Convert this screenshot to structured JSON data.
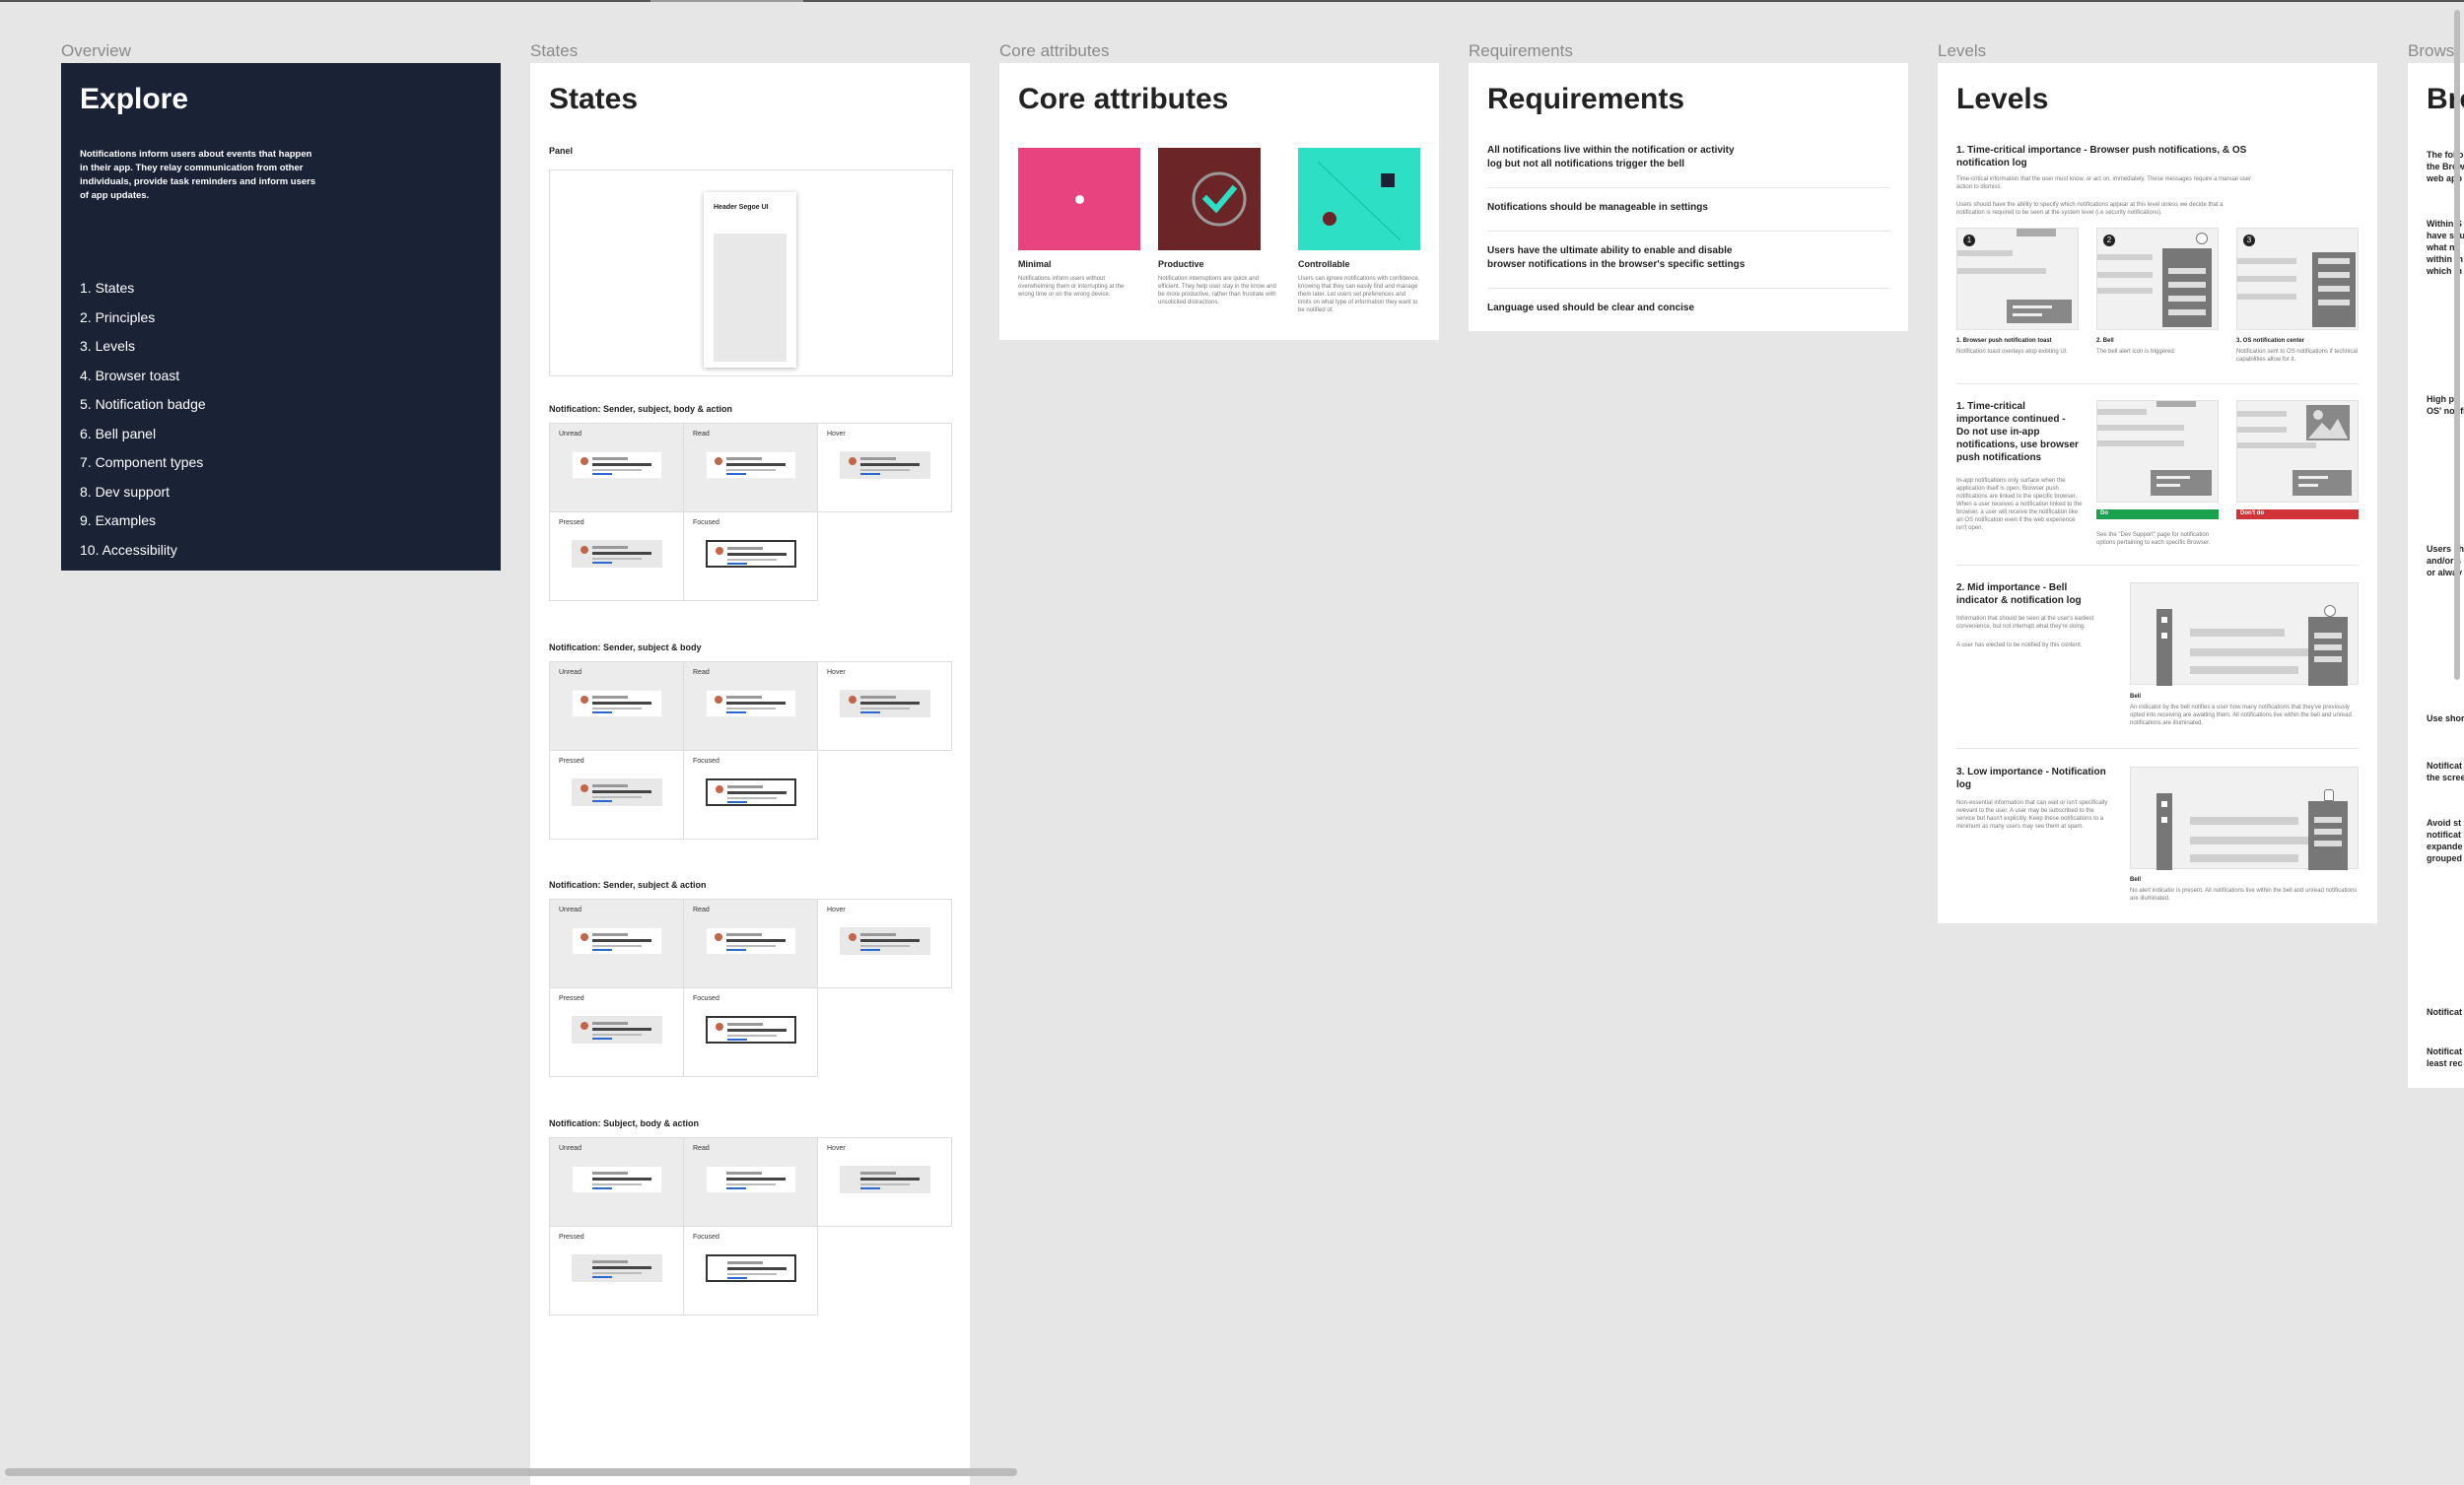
{
  "canvas": {
    "labels": [
      "Overview",
      "States",
      "Core attributes",
      "Requirements",
      "Levels",
      "Browse"
    ]
  },
  "overview": {
    "title": "Explore",
    "intro": "Notifications inform users about events that happen in their app. They relay communication from other individuals, provide task reminders and inform users of app updates.",
    "toc": [
      "1. States",
      "2. Principles",
      "3. Levels",
      "4. Browser toast",
      "5. Notification badge",
      "6. Bell panel",
      "7. Component types",
      "8. Dev support",
      "9. Examples",
      "10. Accessibility"
    ]
  },
  "states": {
    "title": "States",
    "panel_label": "Panel",
    "panel_header": "Header Segoe UI",
    "sections": [
      {
        "title": "Notification: Sender, subject, body & action"
      },
      {
        "title": "Notification: Sender, subject & body"
      },
      {
        "title": "Notification: Sender, subject & action"
      },
      {
        "title": "Notification: Subject, body & action"
      }
    ],
    "cell_labels": [
      "Unread",
      "Read",
      "Hover",
      "Pressed",
      "Focused"
    ]
  },
  "core": {
    "title": "Core attributes",
    "items": [
      {
        "name": "Minimal",
        "desc": "Notifications inform users without overwhelming them or interrupting at the wrong time or on the wrong device.",
        "color": "#e8427f"
      },
      {
        "name": "Productive",
        "desc": "Notification interruptions are quick and efficient. They help user stay in the know and be more productive, rather than frustrate with unsolicited distractions.",
        "color": "#6b2526"
      },
      {
        "name": "Controllable",
        "desc": "Users can ignore notifications with confidence, knowing that they can easily find and manage them later. Let users set preferences and limits on what type of information they want to be notified of.",
        "color": "#2de0c5"
      }
    ]
  },
  "requirements": {
    "title": "Requirements",
    "items": [
      "All notifications live within the notification or activity log but not all notifications trigger the bell",
      "Notifications should be manageable in settings",
      "Users have the ultimate ability to enable and disable browser notifications in the browser's specific settings",
      "Language used should be clear and concise"
    ]
  },
  "levels": {
    "title": "Levels",
    "s1_title": "1. Time-critical importance - Browser push notifications, & OS notification log",
    "s1_desc": "Time-critical information that the user must know, or act on, immediately. These messages require a manual user action to dismiss.",
    "s1_desc2": "Users should have the ability to specify which notifications appear at this level unless we decide that a notification is required to be seen at the system level (i.e security notifications).",
    "s1_captions": [
      {
        "num": "1",
        "title": "1. Browser push notification toast",
        "desc": "Notification toast overlays atop existing UI."
      },
      {
        "num": "2",
        "title": "2. Bell",
        "desc": "The bell alert icon is triggered."
      },
      {
        "num": "3",
        "title": "3. OS notification center",
        "desc": "Notification sent to OS notifications if technical capabilities allow for it."
      }
    ],
    "s2_title": "1. Time-critical importance continued - Do not use in-app notifications, use browser push notifications",
    "s2_desc": "In-app notifications only surface when the application itself is open. Browser push notifications are linked to the specific browser. When a user receives a notification linked to the browser, a user will receive the notification like an OS notification even if the web experience isn't open.",
    "s2_do": "Do",
    "s2_dont": "Don't do",
    "s2_caption": "See the \"Dev Support\" page for notification options pertaining to each specific Browser.",
    "s3_title": "2. Mid importance - Bell indicator & notification log",
    "s3_desc": "Information that should be seen at the user's earliest convenience, but not interrupt what they're doing.",
    "s3_desc2": "A user has elected to be notified by this content.",
    "s3_caption_title": "Bell",
    "s3_caption": "An indicator by the bell notifies a user how many notifications that they've previously opted into receiving are awaiting them. All notifications live within the bell and unread notifications are illuminated.",
    "s4_title": "3. Low importance - Notification log",
    "s4_desc": "Non-essential information that can wait or isn't specifically relevant to the user. A user may be subscribed to the service but hasn't explicitly. Keep these notifications to a minimum as many users may see them at spam.",
    "s4_caption_title": "Bell",
    "s4_caption": "No alert indicator is present. All notifications live within the bell and unread notifications are illuminated."
  },
  "browse": {
    "title": "Bro",
    "lines": [
      "The follo",
      "the Brow",
      "web app",
      "Within S",
      "have situ",
      "what no",
      "within th",
      "which m",
      "High pri",
      "OS' notifi",
      "Users sh",
      "and/or s",
      "or alway",
      "Use shor",
      "Notificat",
      "the scree",
      "Avoid st",
      "notificat",
      "expande",
      "grouped",
      "Notificat",
      "Notificat",
      "least rec"
    ]
  },
  "colors": {
    "overview_bg": "#1a2235",
    "do_green": "#1aa14b",
    "dont_red": "#d13438",
    "link_blue": "#2a6ad0"
  }
}
